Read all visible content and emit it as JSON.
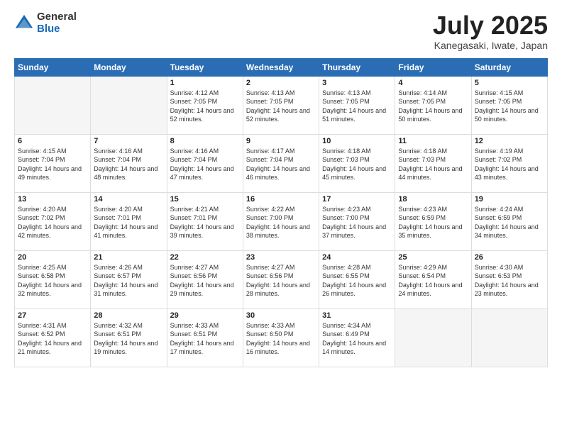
{
  "logo": {
    "general": "General",
    "blue": "Blue"
  },
  "title": "July 2025",
  "subtitle": "Kanegasaki, Iwate, Japan",
  "weekdays": [
    "Sunday",
    "Monday",
    "Tuesday",
    "Wednesday",
    "Thursday",
    "Friday",
    "Saturday"
  ],
  "weeks": [
    [
      {
        "day": "",
        "empty": true
      },
      {
        "day": "",
        "empty": true
      },
      {
        "day": "1",
        "sunrise": "4:12 AM",
        "sunset": "7:05 PM",
        "daylight": "14 hours and 52 minutes."
      },
      {
        "day": "2",
        "sunrise": "4:13 AM",
        "sunset": "7:05 PM",
        "daylight": "14 hours and 52 minutes."
      },
      {
        "day": "3",
        "sunrise": "4:13 AM",
        "sunset": "7:05 PM",
        "daylight": "14 hours and 51 minutes."
      },
      {
        "day": "4",
        "sunrise": "4:14 AM",
        "sunset": "7:05 PM",
        "daylight": "14 hours and 50 minutes."
      },
      {
        "day": "5",
        "sunrise": "4:15 AM",
        "sunset": "7:05 PM",
        "daylight": "14 hours and 50 minutes."
      }
    ],
    [
      {
        "day": "6",
        "sunrise": "4:15 AM",
        "sunset": "7:04 PM",
        "daylight": "14 hours and 49 minutes."
      },
      {
        "day": "7",
        "sunrise": "4:16 AM",
        "sunset": "7:04 PM",
        "daylight": "14 hours and 48 minutes."
      },
      {
        "day": "8",
        "sunrise": "4:16 AM",
        "sunset": "7:04 PM",
        "daylight": "14 hours and 47 minutes."
      },
      {
        "day": "9",
        "sunrise": "4:17 AM",
        "sunset": "7:04 PM",
        "daylight": "14 hours and 46 minutes."
      },
      {
        "day": "10",
        "sunrise": "4:18 AM",
        "sunset": "7:03 PM",
        "daylight": "14 hours and 45 minutes."
      },
      {
        "day": "11",
        "sunrise": "4:18 AM",
        "sunset": "7:03 PM",
        "daylight": "14 hours and 44 minutes."
      },
      {
        "day": "12",
        "sunrise": "4:19 AM",
        "sunset": "7:02 PM",
        "daylight": "14 hours and 43 minutes."
      }
    ],
    [
      {
        "day": "13",
        "sunrise": "4:20 AM",
        "sunset": "7:02 PM",
        "daylight": "14 hours and 42 minutes."
      },
      {
        "day": "14",
        "sunrise": "4:20 AM",
        "sunset": "7:01 PM",
        "daylight": "14 hours and 41 minutes."
      },
      {
        "day": "15",
        "sunrise": "4:21 AM",
        "sunset": "7:01 PM",
        "daylight": "14 hours and 39 minutes."
      },
      {
        "day": "16",
        "sunrise": "4:22 AM",
        "sunset": "7:00 PM",
        "daylight": "14 hours and 38 minutes."
      },
      {
        "day": "17",
        "sunrise": "4:23 AM",
        "sunset": "7:00 PM",
        "daylight": "14 hours and 37 minutes."
      },
      {
        "day": "18",
        "sunrise": "4:23 AM",
        "sunset": "6:59 PM",
        "daylight": "14 hours and 35 minutes."
      },
      {
        "day": "19",
        "sunrise": "4:24 AM",
        "sunset": "6:59 PM",
        "daylight": "14 hours and 34 minutes."
      }
    ],
    [
      {
        "day": "20",
        "sunrise": "4:25 AM",
        "sunset": "6:58 PM",
        "daylight": "14 hours and 32 minutes."
      },
      {
        "day": "21",
        "sunrise": "4:26 AM",
        "sunset": "6:57 PM",
        "daylight": "14 hours and 31 minutes."
      },
      {
        "day": "22",
        "sunrise": "4:27 AM",
        "sunset": "6:56 PM",
        "daylight": "14 hours and 29 minutes."
      },
      {
        "day": "23",
        "sunrise": "4:27 AM",
        "sunset": "6:56 PM",
        "daylight": "14 hours and 28 minutes."
      },
      {
        "day": "24",
        "sunrise": "4:28 AM",
        "sunset": "6:55 PM",
        "daylight": "14 hours and 26 minutes."
      },
      {
        "day": "25",
        "sunrise": "4:29 AM",
        "sunset": "6:54 PM",
        "daylight": "14 hours and 24 minutes."
      },
      {
        "day": "26",
        "sunrise": "4:30 AM",
        "sunset": "6:53 PM",
        "daylight": "14 hours and 23 minutes."
      }
    ],
    [
      {
        "day": "27",
        "sunrise": "4:31 AM",
        "sunset": "6:52 PM",
        "daylight": "14 hours and 21 minutes."
      },
      {
        "day": "28",
        "sunrise": "4:32 AM",
        "sunset": "6:51 PM",
        "daylight": "14 hours and 19 minutes."
      },
      {
        "day": "29",
        "sunrise": "4:33 AM",
        "sunset": "6:51 PM",
        "daylight": "14 hours and 17 minutes."
      },
      {
        "day": "30",
        "sunrise": "4:33 AM",
        "sunset": "6:50 PM",
        "daylight": "14 hours and 16 minutes."
      },
      {
        "day": "31",
        "sunrise": "4:34 AM",
        "sunset": "6:49 PM",
        "daylight": "14 hours and 14 minutes."
      },
      {
        "day": "",
        "empty": true
      },
      {
        "day": "",
        "empty": true
      }
    ]
  ]
}
